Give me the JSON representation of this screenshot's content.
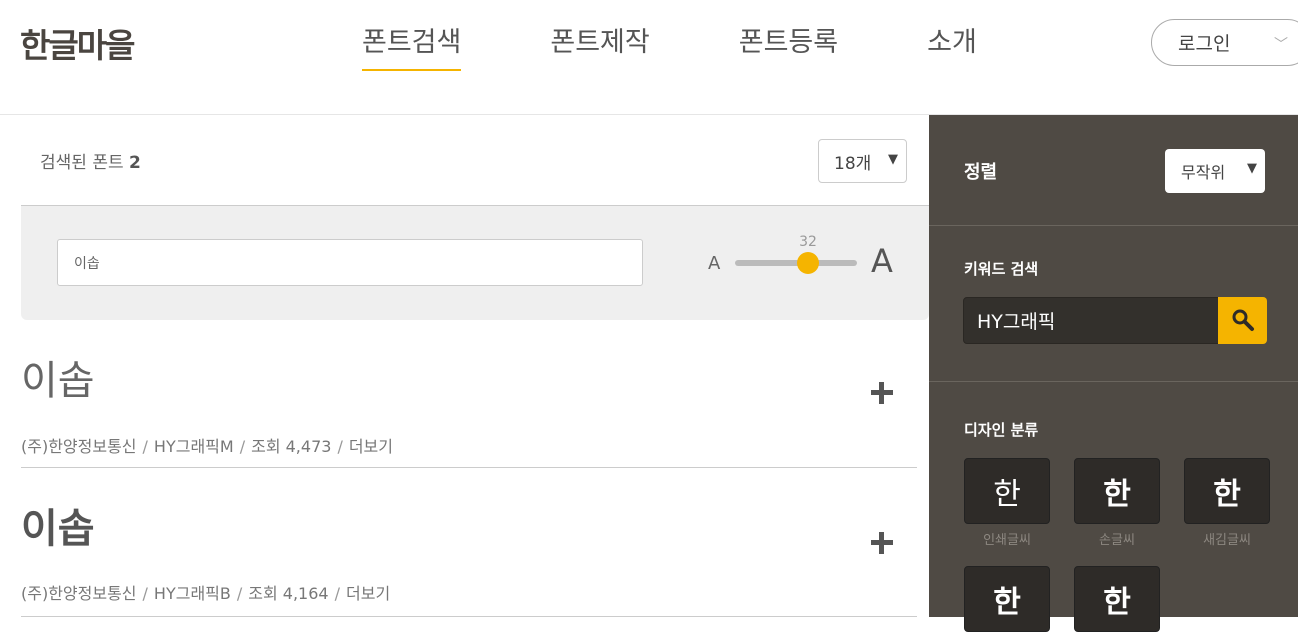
{
  "header": {
    "logo": "한글마을",
    "nav": [
      "폰트검색",
      "폰트제작",
      "폰트등록",
      "소개"
    ],
    "login": "로그인"
  },
  "results": {
    "label": "검색된 폰트",
    "count": "2",
    "per_page": "18개"
  },
  "preview": {
    "text": "이솝",
    "small_a": "A",
    "big_a": "A",
    "size": "32"
  },
  "fonts": [
    {
      "sample": "이솝",
      "company": "(주)한양정보통신",
      "name": "HY그래픽M",
      "views": "조회 4,473",
      "more": "더보기"
    },
    {
      "sample": "이솝",
      "company": "(주)한양정보통신",
      "name": "HY그래픽B",
      "views": "조회 4,164",
      "more": "더보기"
    }
  ],
  "sidebar": {
    "sort_label": "정렬",
    "sort_value": "무작위",
    "keyword_label": "키워드 검색",
    "keyword_value": "HY그래픽",
    "category_label": "디자인 분류",
    "categories": [
      {
        "glyph": "한",
        "name": "인쇄글씨"
      },
      {
        "glyph": "한",
        "name": "손글씨"
      },
      {
        "glyph": "한",
        "name": "새김글씨"
      },
      {
        "glyph": "한",
        "name": ""
      },
      {
        "glyph": "한",
        "name": ""
      }
    ]
  },
  "colors": {
    "accent": "#f5b400",
    "sidebar_bg": "#4f4a44"
  }
}
